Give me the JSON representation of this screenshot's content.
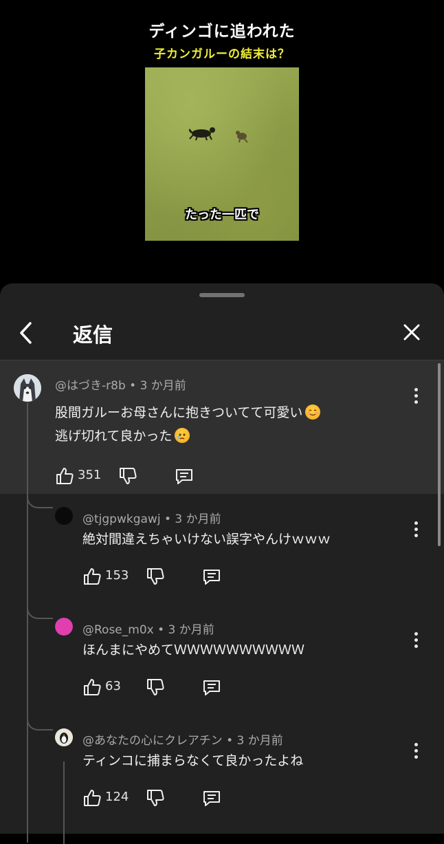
{
  "video": {
    "title_line1": "ディンゴに追われた",
    "title_line2": "子カンガルーの結末は？",
    "caption": "たった一匹で",
    "title2_color": "#f0ee3a"
  },
  "sheet": {
    "title": "返信",
    "back_icon": "chevron-left-icon",
    "close_icon": "close-icon"
  },
  "comments": [
    {
      "author": "@はづき-r8b",
      "time": "3 か月前",
      "lines": [
        "股間ガルーお母さんに抱きついてて可愛い",
        "逃げ切れて良かった"
      ],
      "emoji1": "smiling-face-icon",
      "emoji2": "face-holding-back-tears-icon",
      "likes": "351"
    },
    {
      "author": "@tjgpwkgawj",
      "time": "3 か月前",
      "text": "絶対間違えちゃいけない誤字やんけｗｗｗ",
      "likes": "153"
    },
    {
      "author": "@Rose_m0x",
      "time": "3 か月前",
      "text": "ほんまにやめてＷＷＷＷＷＷＷＷＷＷ",
      "likes": "63",
      "avatar_color": "#e03fb0"
    },
    {
      "author": "@あなたの心にクレアチン",
      "time": "3 か月前",
      "text": "ティンコに捕まらなくて良かったよね",
      "likes": "124"
    }
  ],
  "separator": " • "
}
